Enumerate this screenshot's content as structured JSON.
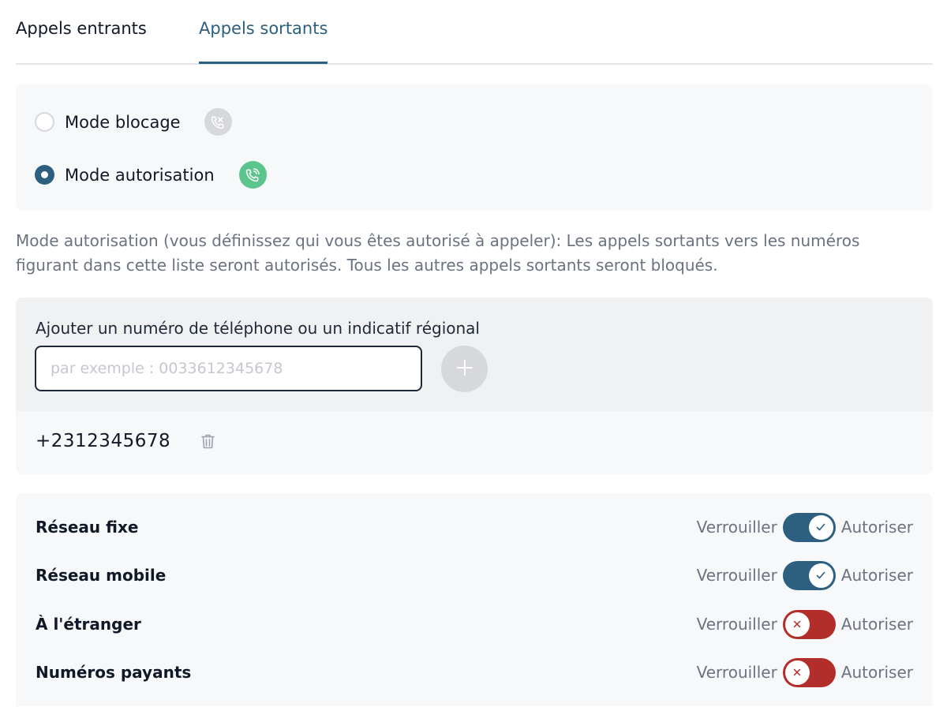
{
  "tabs": [
    {
      "label": "Appels entrants",
      "active": false
    },
    {
      "label": "Appels sortants",
      "active": true
    }
  ],
  "modes": [
    {
      "label": "Mode blocage",
      "selected": false,
      "icon": "phone-blocked-icon"
    },
    {
      "label": "Mode autorisation",
      "selected": true,
      "icon": "phone-allowed-icon"
    }
  ],
  "description": "Mode autorisation (vous définissez qui vous êtes autorisé à appeler): Les appels sortants vers les numéros figurant dans cette liste seront autorisés. Tous les autres appels sortants seront bloqués.",
  "add_number": {
    "label": "Ajouter un numéro de téléphone ou un indicatif régional",
    "placeholder": "par exemple : 0033612345678",
    "value": "",
    "add_icon": "plus-icon"
  },
  "numbers": [
    {
      "value": "+2312345678",
      "delete_icon": "trash-icon"
    }
  ],
  "networks": [
    {
      "name": "Réseau fixe",
      "left_label": "Verrouiller",
      "right_label": "Autoriser",
      "state": "allowed"
    },
    {
      "name": "Réseau mobile",
      "left_label": "Verrouiller",
      "right_label": "Autoriser",
      "state": "allowed"
    },
    {
      "name": "À l'étranger",
      "left_label": "Verrouiller",
      "right_label": "Autoriser",
      "state": "blocked"
    },
    {
      "name": "Numéros payants",
      "left_label": "Verrouiller",
      "right_label": "Autoriser",
      "state": "blocked"
    }
  ],
  "colors": {
    "accent": "#2d5f80",
    "allowed_toggle": "#2d5f80",
    "blocked_toggle": "#b22e2a",
    "allow_mode_icon": "#5cc48d",
    "block_mode_icon": "#d6d8dc"
  }
}
